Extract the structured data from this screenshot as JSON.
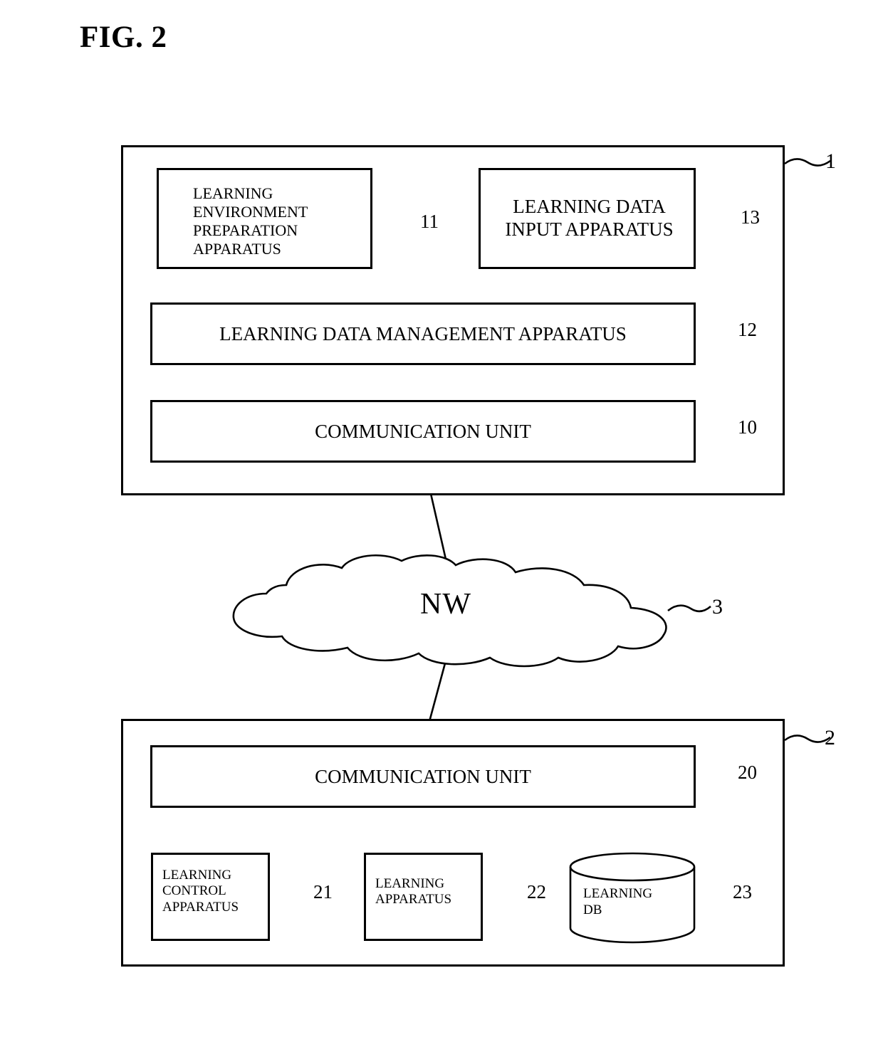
{
  "figure": {
    "title": "FIG. 2"
  },
  "systems": {
    "learning_client_system": {
      "ref": "1",
      "components": [
        {
          "ref": "11",
          "label": "LEARNING\nENVIRONMENT\nPREPARATION\nAPPARATUS"
        },
        {
          "ref": "13",
          "label": "LEARNING DATA\nINPUT APPARATUS"
        },
        {
          "ref": "12",
          "label": "LEARNING DATA MANAGEMENT APPARATUS"
        },
        {
          "ref": "10",
          "label": "COMMUNICATION UNIT"
        }
      ]
    },
    "network": {
      "ref": "3",
      "label": "NW"
    },
    "learning_server_system": {
      "ref": "2",
      "components": [
        {
          "ref": "20",
          "label": "COMMUNICATION UNIT"
        },
        {
          "ref": "21",
          "label": "LEARNING\nCONTROL\nAPPARATUS"
        },
        {
          "ref": "22",
          "label": "LEARNING\nAPPARATUS"
        },
        {
          "ref": "23",
          "label": "LEARNING\nDB"
        }
      ]
    }
  },
  "colors": {
    "line": "#000000",
    "background": "#ffffff"
  }
}
